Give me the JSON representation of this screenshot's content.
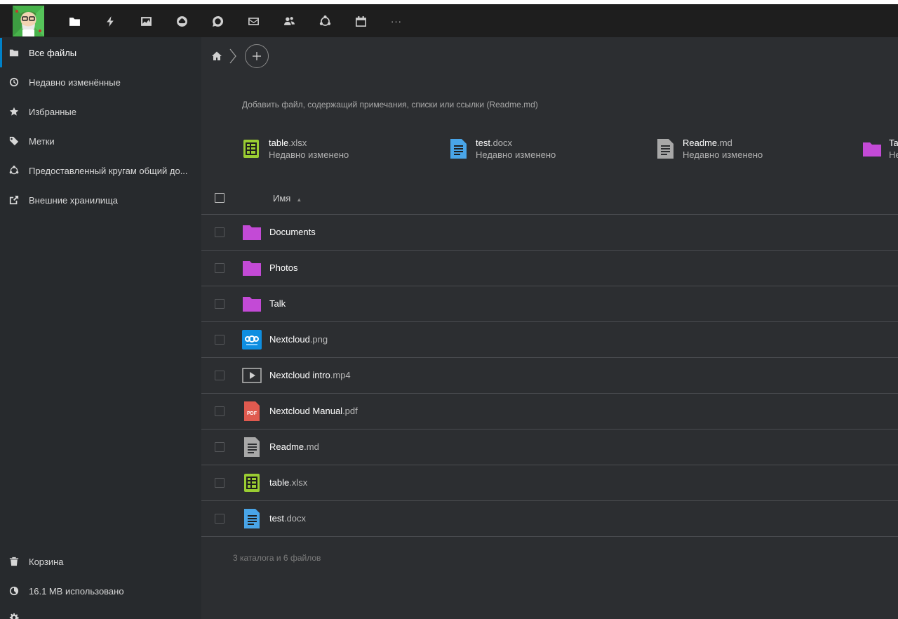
{
  "topbar": {
    "apps": [
      {
        "name": "files",
        "icon": "folder-icon"
      },
      {
        "name": "activity",
        "icon": "lightning-icon"
      },
      {
        "name": "photos",
        "icon": "image-icon"
      },
      {
        "name": "deck",
        "icon": "cloud-circle-icon"
      },
      {
        "name": "talk",
        "icon": "chat-icon"
      },
      {
        "name": "mail",
        "icon": "mail-icon"
      },
      {
        "name": "contacts",
        "icon": "contacts-icon"
      },
      {
        "name": "circles",
        "icon": "circles-icon"
      },
      {
        "name": "calendar",
        "icon": "calendar-icon"
      },
      {
        "name": "more",
        "icon": "more-icon",
        "label": "···"
      }
    ]
  },
  "sidebar": {
    "items": [
      {
        "label": "Все файлы",
        "icon": "folder-icon"
      },
      {
        "label": "Недавно изменённые",
        "icon": "clock-icon"
      },
      {
        "label": "Избранные",
        "icon": "star-icon"
      },
      {
        "label": "Метки",
        "icon": "tag-icon"
      },
      {
        "label": "Предоставленный кругам общий до...",
        "icon": "circles-icon"
      },
      {
        "label": "Внешние хранилища",
        "icon": "external-icon"
      }
    ],
    "bottom": [
      {
        "label": "Корзина",
        "icon": "trash-icon"
      },
      {
        "label": "16.1 MB использовано",
        "icon": "quota-icon"
      }
    ]
  },
  "main": {
    "readme_prompt": "Добавить файл, содержащий примечания, списки или ссылки (Readme.md)",
    "recent": [
      {
        "name": "table",
        "ext": ".xlsx",
        "sub": "Недавно изменено",
        "icon": "spreadsheet-icon"
      },
      {
        "name": "test",
        "ext": ".docx",
        "sub": "Недавно изменено",
        "icon": "document-icon"
      },
      {
        "name": "Readme",
        "ext": ".md",
        "sub": "Недавно изменено",
        "icon": "text-file-icon"
      },
      {
        "name": "Ta",
        "ext": "",
        "sub": "Не",
        "icon": "folder-icon"
      }
    ],
    "list_header": {
      "name": "Имя",
      "sort_arrow": "▲"
    },
    "files": [
      {
        "name": "Documents",
        "ext": "",
        "icon": "folder-icon"
      },
      {
        "name": "Photos",
        "ext": "",
        "icon": "folder-icon"
      },
      {
        "name": "Talk",
        "ext": "",
        "icon": "folder-icon"
      },
      {
        "name": "Nextcloud",
        "ext": ".png",
        "icon": "image-file-icon"
      },
      {
        "name": "Nextcloud intro",
        "ext": ".mp4",
        "icon": "video-file-icon"
      },
      {
        "name": "Nextcloud Manual",
        "ext": ".pdf",
        "icon": "pdf-file-icon"
      },
      {
        "name": "Readme",
        "ext": ".md",
        "icon": "text-file-icon"
      },
      {
        "name": "table",
        "ext": ".xlsx",
        "icon": "spreadsheet-icon"
      },
      {
        "name": "test",
        "ext": ".docx",
        "icon": "document-icon"
      }
    ],
    "summary": "3 каталога и 6 файлов"
  },
  "colors": {
    "accent": "#0082c9",
    "folder": "#c34ad6",
    "spreadsheet": "#9acd32",
    "document": "#49a5e8",
    "pdf": "#e05a4f"
  }
}
